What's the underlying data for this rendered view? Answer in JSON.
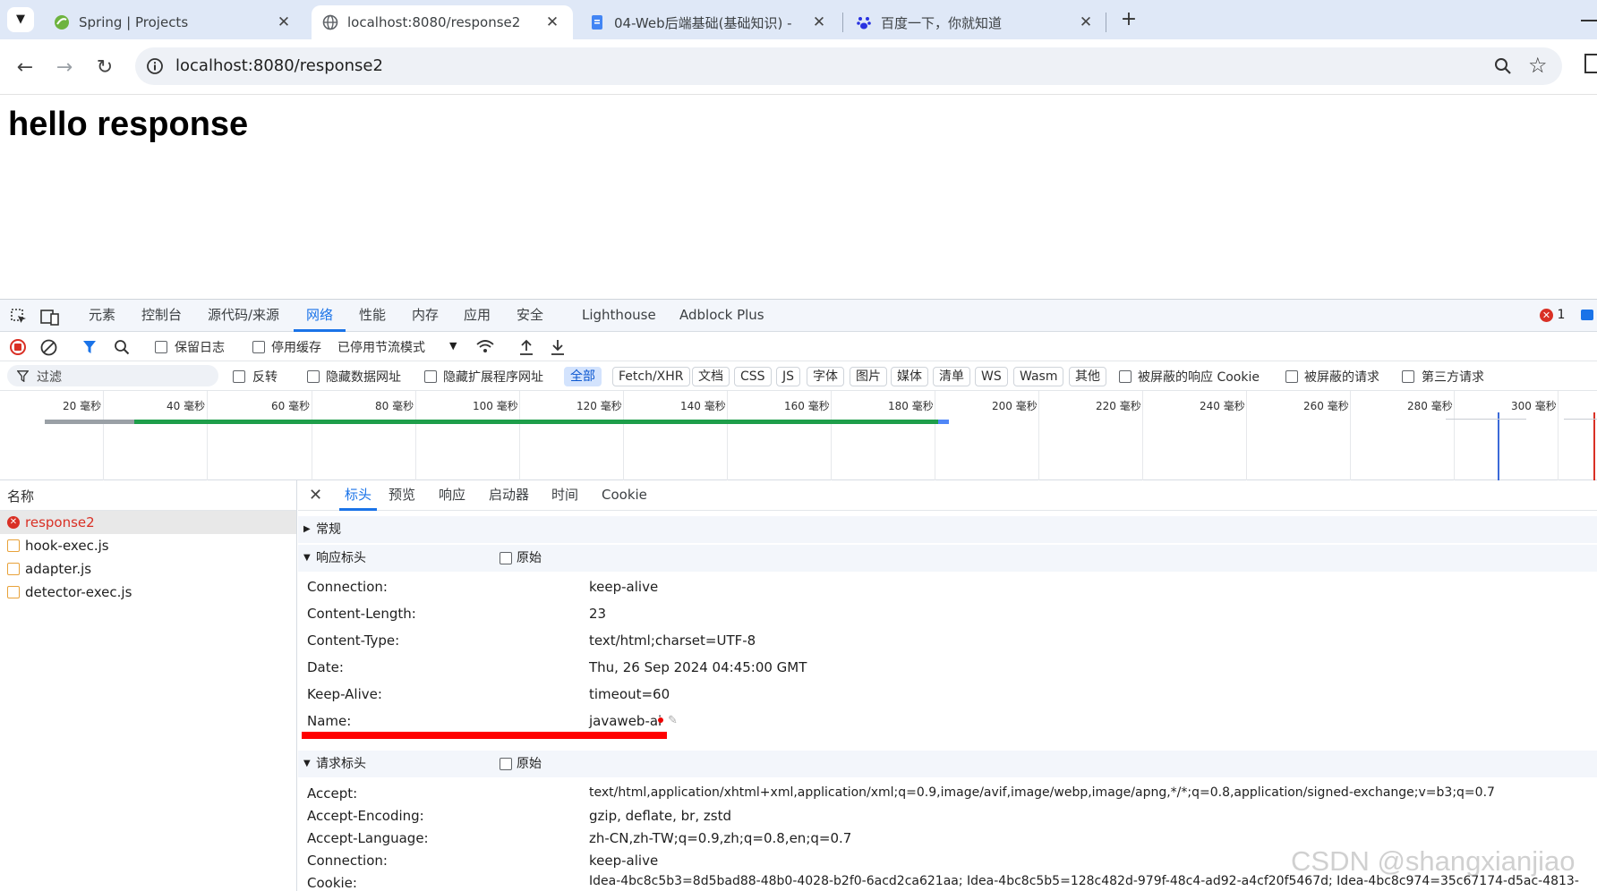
{
  "tabs": [
    {
      "title": "Spring | Projects",
      "icon": "spring-icon",
      "close": "✕"
    },
    {
      "title": "localhost:8080/response2",
      "icon": "globe-icon",
      "close": "✕"
    },
    {
      "title": "04-Web后端基础(基础知识) -",
      "icon": "doc-icon",
      "close": "✕"
    },
    {
      "title": "百度一下，你就知道",
      "icon": "baidu-icon",
      "close": "✕"
    }
  ],
  "new_tab_label": "+",
  "address": {
    "url": "localhost:8080/response2"
  },
  "page": {
    "heading": "hello response"
  },
  "devtools": {
    "tabs": [
      "元素",
      "控制台",
      "源代码/来源",
      "网络",
      "性能",
      "内存",
      "应用",
      "安全",
      "Lighthouse",
      "Adblock Plus"
    ],
    "error_count": "1",
    "net_toolbar": {
      "preserve_log": "保留日志",
      "disable_cache": "停用缓存",
      "throttle": "已停用节流模式"
    },
    "filter": {
      "placeholder": "过滤",
      "invert": "反转",
      "hide_data_urls": "隐藏数据网址",
      "hide_ext_urls": "隐藏扩展程序网址",
      "chips": [
        "全部",
        "Fetch/XHR",
        "文档",
        "CSS",
        "JS",
        "字体",
        "图片",
        "媒体",
        "清单",
        "WS",
        "Wasm",
        "其他"
      ],
      "blocked_cookies": "被屏蔽的响应 Cookie",
      "blocked_requests": "被屏蔽的请求",
      "third_party": "第三方请求"
    },
    "timeline_ticks": [
      "20 毫秒",
      "40 毫秒",
      "60 毫秒",
      "80 毫秒",
      "100 毫秒",
      "120 毫秒",
      "140 毫秒",
      "160 毫秒",
      "180 毫秒",
      "200 毫秒",
      "220 毫秒",
      "240 毫秒",
      "260 毫秒",
      "280 毫秒",
      "300 毫秒"
    ],
    "list_header": "名称",
    "requests": [
      {
        "name": "response2",
        "status": "error"
      },
      {
        "name": "hook-exec.js",
        "status": "ok"
      },
      {
        "name": "adapter.js",
        "status": "ok"
      },
      {
        "name": "detector-exec.js",
        "status": "ok"
      }
    ],
    "detail_tabs": [
      "标头",
      "预览",
      "响应",
      "启动器",
      "时间",
      "Cookie"
    ],
    "sections": {
      "general": "常规",
      "response_headers": "响应标头",
      "request_headers": "请求标头",
      "raw": "原始"
    },
    "response_headers": [
      {
        "k": "Connection:",
        "v": "keep-alive"
      },
      {
        "k": "Content-Length:",
        "v": "23"
      },
      {
        "k": "Content-Type:",
        "v": "text/html;charset=UTF-8"
      },
      {
        "k": "Date:",
        "v": "Thu, 26 Sep 2024 04:45:00 GMT"
      },
      {
        "k": "Keep-Alive:",
        "v": "timeout=60"
      },
      {
        "k": "Name:",
        "v": "javaweb-ai"
      }
    ],
    "request_headers": [
      {
        "k": "Accept:",
        "v": "text/html,application/xhtml+xml,application/xml;q=0.9,image/avif,image/webp,image/apng,*/*;q=0.8,application/signed-exchange;v=b3;q=0.7"
      },
      {
        "k": "Accept-Encoding:",
        "v": "gzip, deflate, br, zstd"
      },
      {
        "k": "Accept-Language:",
        "v": "zh-CN,zh-TW;q=0.9,zh;q=0.8,en;q=0.7"
      },
      {
        "k": "Connection:",
        "v": "keep-alive"
      },
      {
        "k": "Cookie:",
        "v": "Idea-4bc8c5b3=8d5bad88-48b0-4028-b2f0-6acd2ca621aa; Idea-4bc8c5b5=128c482d-979f-48c4-ad92-a4cf20f5467d; Idea-4bc8c974=35c67174-d5ac-4813-"
      }
    ]
  },
  "watermark": "CSDN @shangxianjiao",
  "colors": {
    "accent": "#1a73e8",
    "error": "#d93025",
    "highlight": "#ff0000",
    "waterfall": "#1e9e4a"
  }
}
